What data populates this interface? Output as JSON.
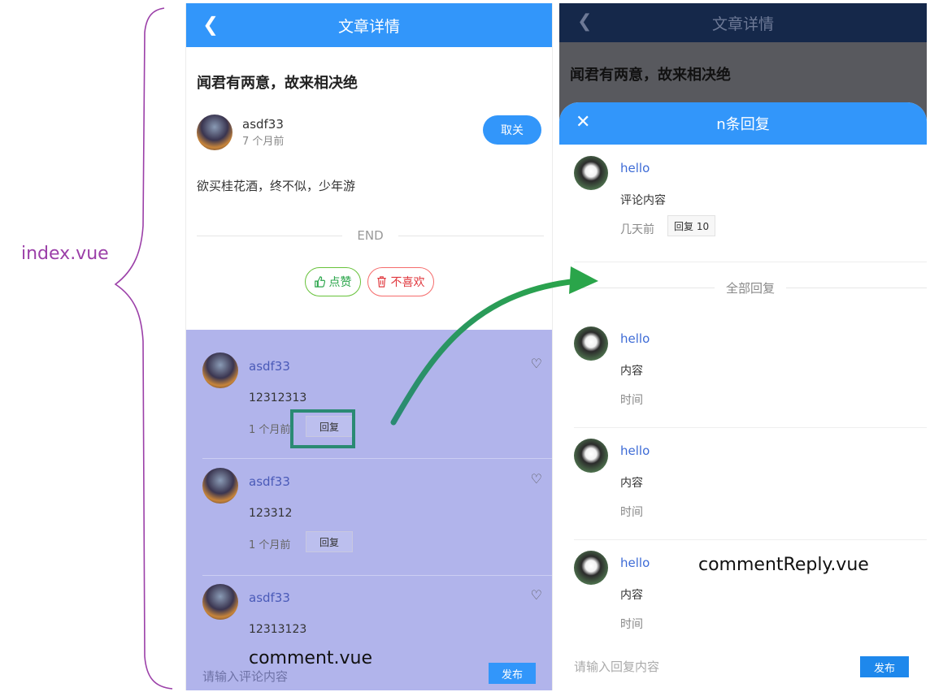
{
  "annotations": {
    "index_label": "index.vue",
    "comment_label": "comment.vue",
    "reply_label": "commentReply.vue"
  },
  "colors": {
    "primary": "#3296fa",
    "brace": "#9b3fa8",
    "overlay": "#8c90e2",
    "arrow": "#2aa54a",
    "highlight": "#2a8a73"
  },
  "left_screen": {
    "nav": {
      "back_icon": "chevron-left-icon",
      "title": "文章详情"
    },
    "article_title": "闻君有两意，故来相决绝",
    "author": {
      "name": "asdf33",
      "time": "7 个月前",
      "follow_label": "取关"
    },
    "content": "欲买桂花酒，终不似，少年游",
    "end_text": "END",
    "like_label": "点赞",
    "dislike_label": "不喜欢",
    "comments": [
      {
        "name": "asdf33",
        "content": "12312313",
        "time": "1 个月前",
        "reply_label": "回复"
      },
      {
        "name": "asdf33",
        "content": "123312",
        "time": "1 个月前",
        "reply_label": "回复"
      },
      {
        "name": "asdf33",
        "content": "12313123",
        "time": "",
        "reply_label": ""
      }
    ],
    "input_placeholder": "请输入评论内容",
    "publish_label": "发布"
  },
  "right_screen": {
    "nav": {
      "back_icon": "chevron-left-icon",
      "title": "文章详情"
    },
    "article_title": "闻君有两意，故来相决绝",
    "popup": {
      "close_icon": "close-icon",
      "title": "n条回复",
      "main_comment": {
        "name": "hello",
        "content": "评论内容",
        "time": "几天前",
        "reply_label": "回复 10"
      },
      "all_replies_label": "全部回复",
      "replies": [
        {
          "name": "hello",
          "content": "内容",
          "time": "时间"
        },
        {
          "name": "hello",
          "content": "内容",
          "time": "时间"
        },
        {
          "name": "hello",
          "content": "内容",
          "time": "时间"
        }
      ],
      "input_placeholder": "请输入回复内容",
      "publish_label": "发布"
    }
  }
}
